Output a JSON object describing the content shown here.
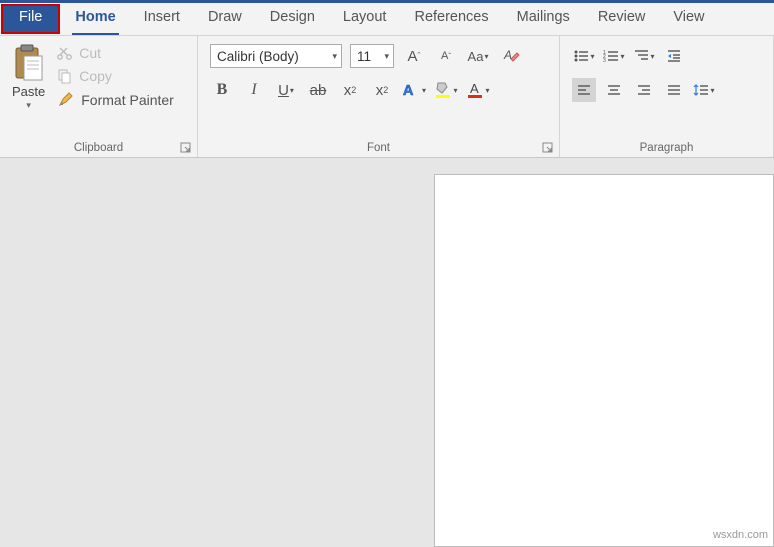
{
  "tabs": {
    "file": "File",
    "home": "Home",
    "insert": "Insert",
    "draw": "Draw",
    "design": "Design",
    "layout": "Layout",
    "references": "References",
    "mailings": "Mailings",
    "review": "Review",
    "view": "View"
  },
  "clipboard": {
    "paste": "Paste",
    "cut": "Cut",
    "copy": "Copy",
    "format_painter": "Format Painter",
    "label": "Clipboard"
  },
  "font": {
    "name": "Calibri (Body)",
    "size": "11",
    "label": "Font"
  },
  "paragraph": {
    "label": "Paragraph"
  },
  "watermark": "wsxdn.com"
}
